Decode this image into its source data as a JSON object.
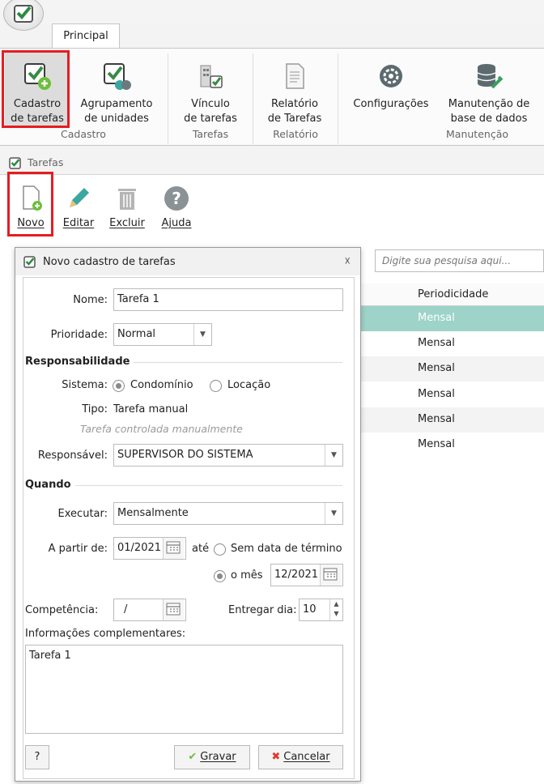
{
  "ribbon": {
    "tab": "Principal",
    "buttons": {
      "cadastro_tarefas": [
        "Cadastro",
        "de tarefas"
      ],
      "agrupamento": [
        "Agrupamento",
        "de unidades"
      ],
      "vinculo": [
        "Vínculo",
        "de tarefas"
      ],
      "relatorio": [
        "Relatório",
        "de Tarefas"
      ],
      "configuracoes": [
        "Configurações"
      ],
      "manutencao": [
        "Manutenção de",
        "base de dados"
      ]
    },
    "groups": {
      "cadastro": "Cadastro",
      "tarefas": "Tarefas",
      "relatorio": "Relatório",
      "manutencao": "Manutenção"
    }
  },
  "window": {
    "title": "Tarefas",
    "toolbar": {
      "novo": "Novo",
      "editar": "Editar",
      "excluir": "Excluir",
      "ajuda": "Ajuda"
    },
    "search_placeholder": "Digite sua pesquisa aqui...",
    "grid": {
      "column": "Periodicidade",
      "rows": [
        "Mensal",
        "Mensal",
        "Mensal",
        "Mensal",
        "Mensal",
        "Mensal"
      ]
    }
  },
  "dialog": {
    "title": "Novo cadastro de tarefas",
    "close": "☓",
    "nome_label": "Nome:",
    "nome_value": "Tarefa 1",
    "prioridade_label": "Prioridade:",
    "prioridade_value": "Normal",
    "responsabilidade_title": "Responsabilidade",
    "sistema_label": "Sistema:",
    "sistema_opt1": "Condomínio",
    "sistema_opt2": "Locação",
    "tipo_label": "Tipo:",
    "tipo_value": "Tarefa manual",
    "tipo_hint": "Tarefa controlada manualmente",
    "responsavel_label": "Responsável:",
    "responsavel_value": "SUPERVISOR DO SISTEMA",
    "quando_title": "Quando",
    "executar_label": "Executar:",
    "executar_value": "Mensalmente",
    "apartir_label": "A partir de:",
    "apartir_value": "01/2021",
    "ate_label": "até",
    "sem_data": "Sem data de término",
    "o_mes": "o mês",
    "o_mes_value": "12/2021",
    "competencia_label": "Competência:",
    "competencia_value": "/",
    "entregar_label": "Entregar dia:",
    "entregar_value": "10",
    "info_label": "Informações complementares:",
    "info_value": "Tarefa 1",
    "help": "?",
    "gravar": "Gravar",
    "cancelar": "Cancelar"
  },
  "colors": {
    "highlight": "#e41d22",
    "selected_row": "#9dd3c8",
    "icon_green": "#3a8a47"
  }
}
